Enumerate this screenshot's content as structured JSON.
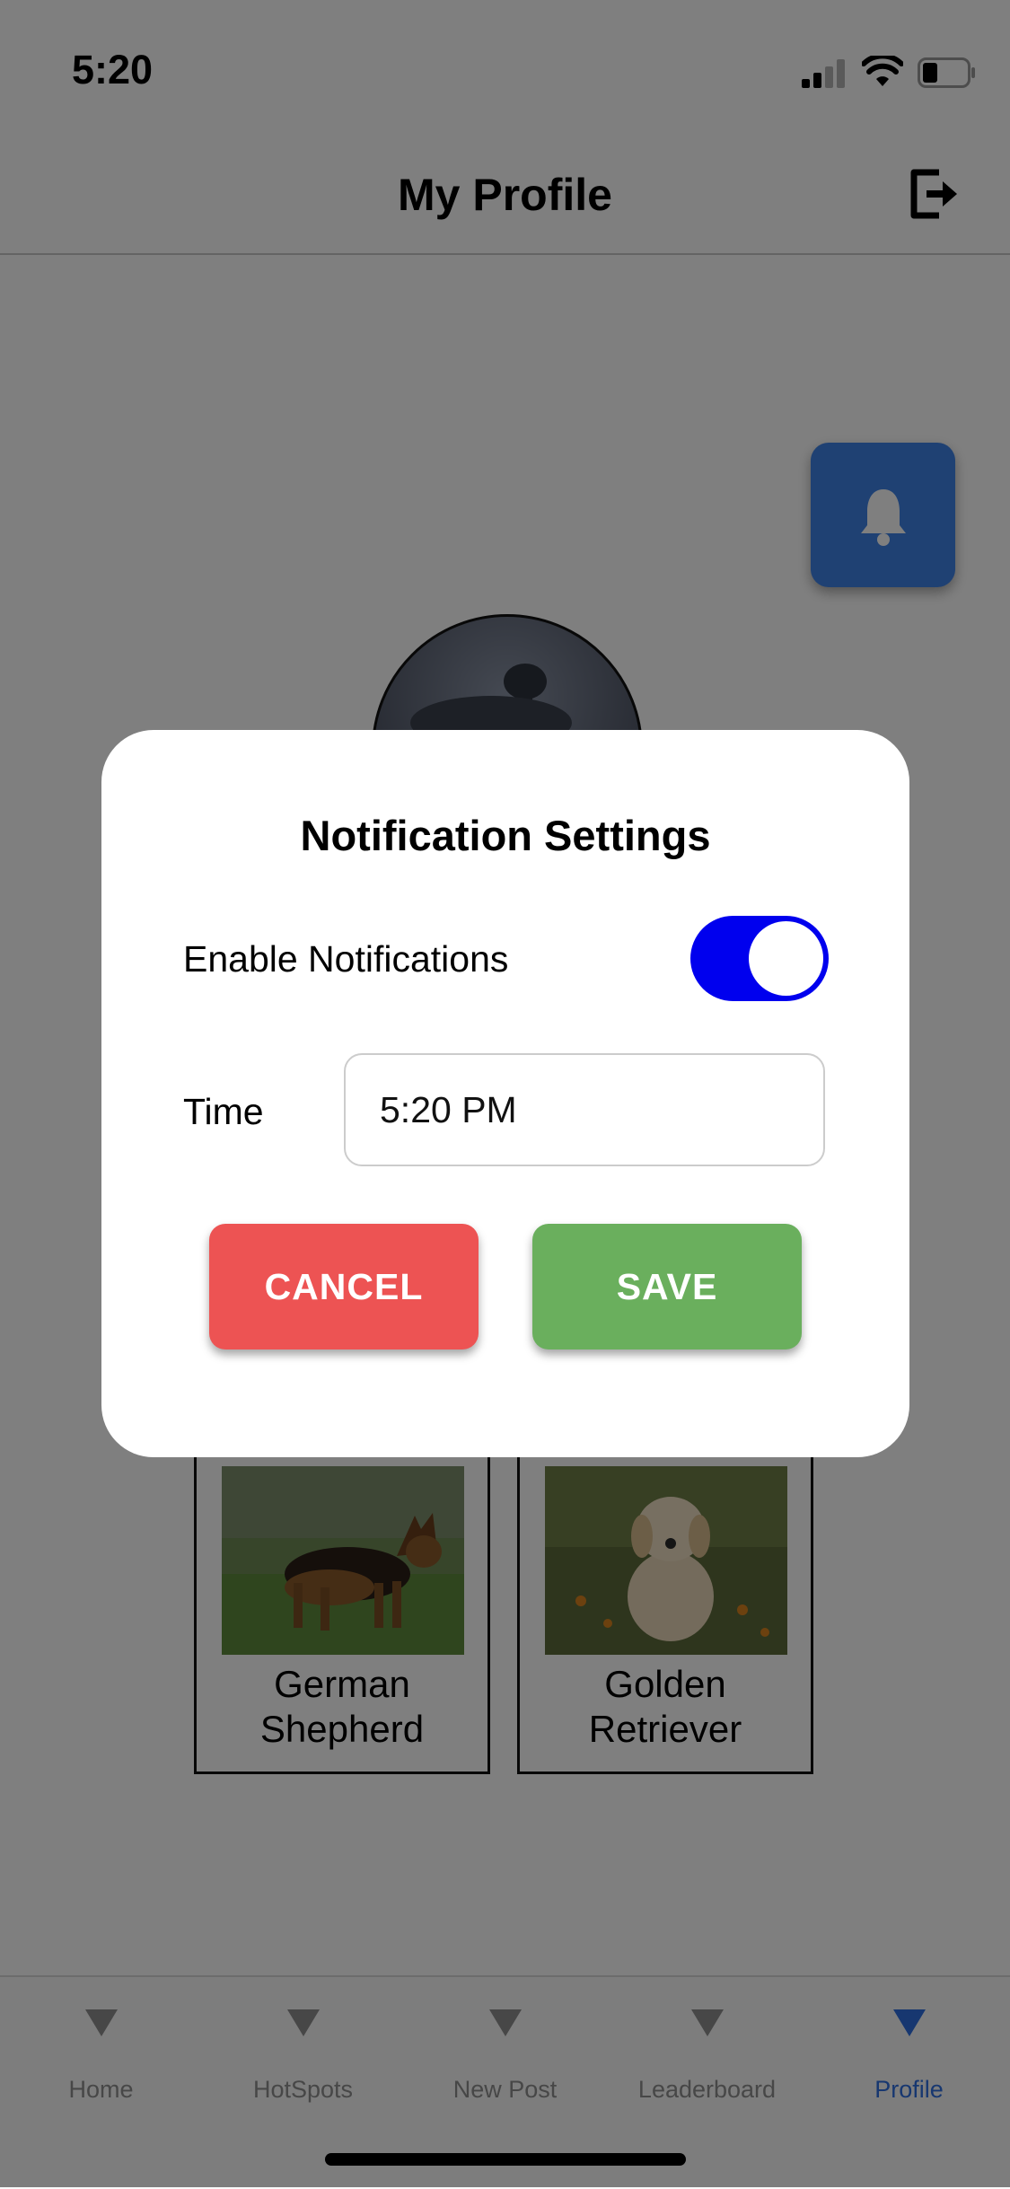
{
  "status_bar": {
    "time": "5:20"
  },
  "header": {
    "title": "My Profile"
  },
  "breeds": [
    {
      "name": "German\nShepherd"
    },
    {
      "name": "Golden\nRetriever"
    }
  ],
  "tabs": [
    {
      "label": "Home"
    },
    {
      "label": "HotSpots"
    },
    {
      "label": "New Post"
    },
    {
      "label": "Leaderboard"
    },
    {
      "label": "Profile",
      "active": true
    }
  ],
  "modal": {
    "title": "Notification Settings",
    "enable_label": "Enable Notifications",
    "enabled": true,
    "time_label": "Time",
    "time_value": "5:20 PM",
    "cancel_label": "CANCEL",
    "save_label": "SAVE"
  },
  "colors": {
    "accent_blue": "#2f6fe0",
    "bell_button": "#3f82e6",
    "toggle_on": "#0000ee",
    "cancel": "#ed5353",
    "save": "#6aaf5d"
  },
  "icons": [
    "signal-icon",
    "wifi-icon",
    "battery-icon",
    "logout-icon",
    "bell-icon"
  ]
}
